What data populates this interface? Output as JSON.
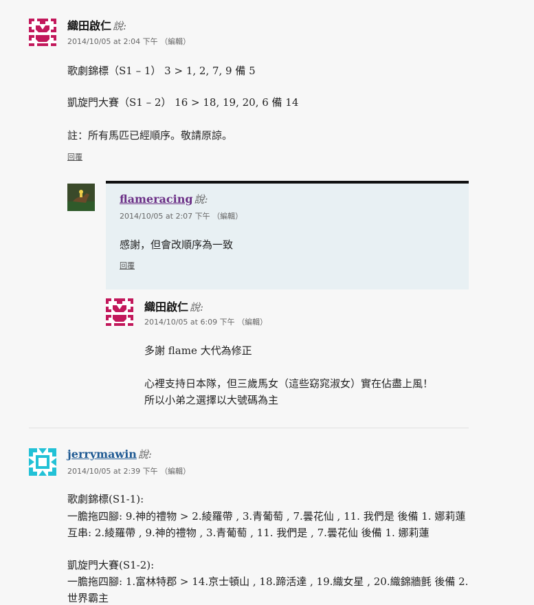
{
  "comments": [
    {
      "author": "織田啟仁",
      "says": "說:",
      "meta": "2014/10/05 at 2:04 下午 （編輯）",
      "lines": [
        "歌劇錦標（S1 – 1） 3 > 1, 2, 7, 9 備 5",
        "凱旋門大賽（S1 – 2） 16 > 18, 19, 20, 6 備 14",
        "註：所有馬匹已經順序。敬請原諒。"
      ],
      "reply": "回覆"
    },
    {
      "author": "flameracing",
      "says": "說:",
      "meta": "2014/10/05 at 2:07 下午 （編輯）",
      "lines": [
        "感謝，但會改順序為一致"
      ],
      "reply": "回覆"
    },
    {
      "author": "織田啟仁",
      "says": "說:",
      "meta": "2014/10/05 at 6:09 下午 （編輯）",
      "lines": [
        "多謝 flame 大代為修正",
        "心裡支持日本隊，但三歲馬女（這些窈窕淑女）實在佔盡上風！",
        "所以小弟之選擇以大號碼為主"
      ]
    },
    {
      "author": "jerrymawin",
      "says": "說:",
      "meta": "2014/10/05 at 2:39 下午 （編輯）",
      "lines": [
        "歌劇錦標(S1-1):",
        "一膽拖四腳: 9.神的禮物 > 2.綾羅帶 , 3.青葡萄 , 7.曇花仙 , 11. 我們是 後備 1. 娜莉蓮",
        "互串: 2.綾羅帶 , 9.神的禮物 , 3.青葡萄 , 11. 我們是 , 7.曇花仙 後備 1. 娜莉蓮",
        "凱旋門大賽(S1-2):",
        "一膽拖四腳: 1.富林特郡 > 14.京士頓山 , 18.蹄活達 , 19.織女星 , 20.織錦牆氈 後備 2.",
        "世界霸主"
      ]
    }
  ],
  "colors": {
    "avatar1": "#c2185b",
    "avatar3": "#22c1d6",
    "link": "#6b2f86",
    "link2": "#1f5a93"
  },
  "icons": [
    "identicon-avatar",
    "horse-photo-avatar",
    "identicon-avatar",
    "identicon-avatar"
  ]
}
